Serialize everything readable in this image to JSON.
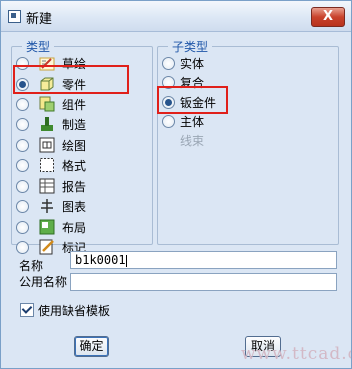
{
  "window": {
    "title": "新建",
    "close_label": "X"
  },
  "type_group": {
    "title": "类型",
    "items": [
      {
        "label": "草绘",
        "icon": "sketch-icon"
      },
      {
        "label": "零件",
        "icon": "part-icon",
        "selected": true
      },
      {
        "label": "组件",
        "icon": "assembly-icon"
      },
      {
        "label": "制造",
        "icon": "manufacturing-icon"
      },
      {
        "label": "绘图",
        "icon": "drawing-icon"
      },
      {
        "label": "格式",
        "icon": "format-icon"
      },
      {
        "label": "报告",
        "icon": "report-icon"
      },
      {
        "label": "图表",
        "icon": "diagram-icon"
      },
      {
        "label": "布局",
        "icon": "layout-icon"
      },
      {
        "label": "标记",
        "icon": "markup-icon"
      }
    ]
  },
  "subtype_group": {
    "title": "子类型",
    "items": [
      {
        "label": "实体"
      },
      {
        "label": "复合"
      },
      {
        "label": "钣金件",
        "selected": true
      },
      {
        "label": "主体"
      },
      {
        "label": "线束",
        "disabled": true
      }
    ]
  },
  "name_field": {
    "label": "名称",
    "value": "b1k0001"
  },
  "common_name_field": {
    "label": "公用名称",
    "value": ""
  },
  "use_default_template": {
    "label": "使用缺省模板",
    "checked": true
  },
  "buttons": {
    "ok": "确定",
    "cancel": "取消"
  },
  "watermark": "www.ttcad.com",
  "colors": {
    "group_title": "#1f56a8",
    "highlight": "#e0201a",
    "window_bg": "#dbe6f4"
  }
}
